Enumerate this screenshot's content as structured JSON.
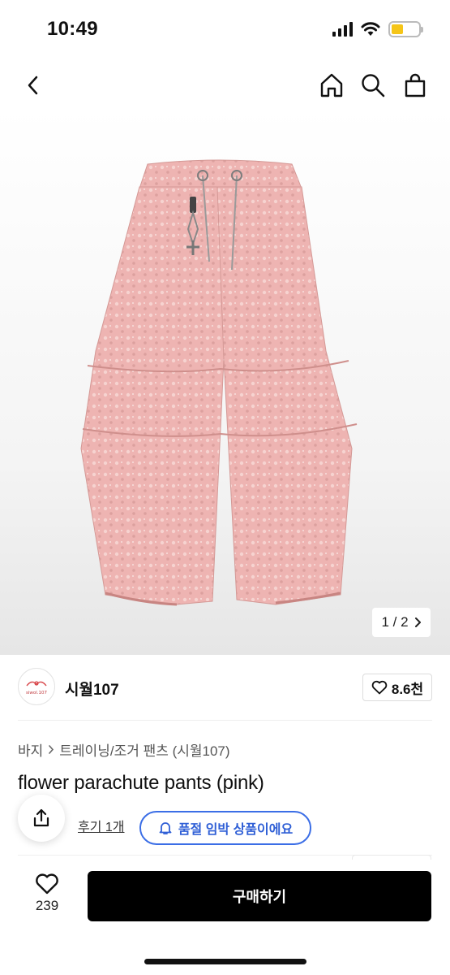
{
  "status_bar": {
    "time": "10:49"
  },
  "product": {
    "image_alt": "flower parachute pants (pink)",
    "page_indicator": "1 / 2",
    "shop_name": "시월107",
    "shop_logo_text": "siwol.107",
    "likes": "8.6천",
    "breadcrumb": [
      "바지",
      "트레이닝/조거 팬츠 (시월107)"
    ],
    "title": "flower parachute pants (pink)",
    "review_link": "후기 1개",
    "soldout_badge": "품절 임박 상품이에요"
  },
  "bottom_bar": {
    "wish_count": "239",
    "buy_label": "구매하기"
  },
  "colors": {
    "accent_blue": "#3b6ee6",
    "pants_pink": "#eeb4b2",
    "battery": "#f5c518"
  }
}
